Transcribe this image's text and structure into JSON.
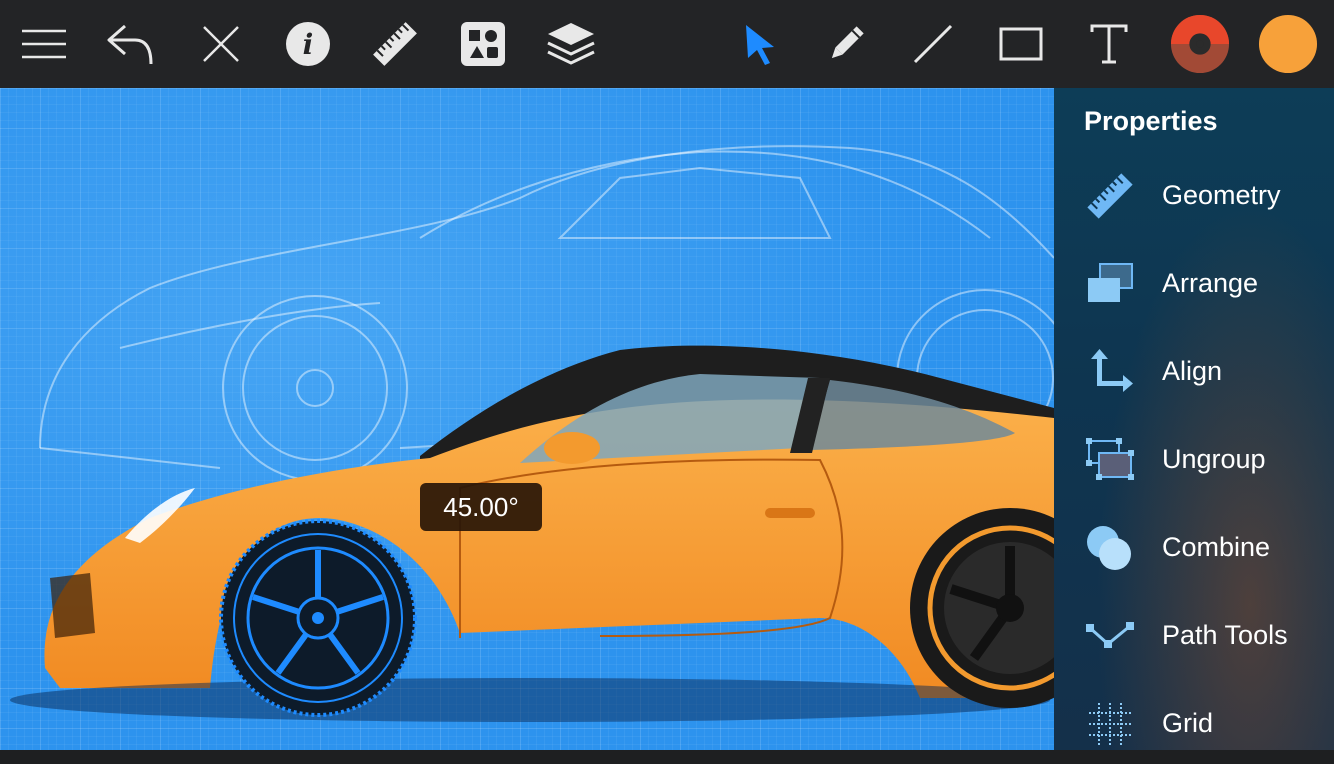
{
  "toolbar": {
    "left_icons": [
      "menu-icon",
      "undo-icon",
      "close-icon",
      "info-icon",
      "ruler-icon",
      "shapes-icon",
      "layers-icon"
    ],
    "tools": [
      "select-arrow-icon",
      "pencil-icon",
      "line-icon",
      "rectangle-icon",
      "text-icon"
    ],
    "active_tool": "select-arrow-icon",
    "stroke_color": "#e8472b",
    "fill_color": "#f7a13a",
    "accent_color": "#1e8bff"
  },
  "canvas": {
    "angle_readout": "45.00°"
  },
  "properties": {
    "title": "Properties",
    "items": [
      {
        "label": "Geometry",
        "icon": "ruler-icon"
      },
      {
        "label": "Arrange",
        "icon": "arrange-icon"
      },
      {
        "label": "Align",
        "icon": "align-icon"
      },
      {
        "label": "Ungroup",
        "icon": "ungroup-icon"
      },
      {
        "label": "Combine",
        "icon": "combine-icon"
      },
      {
        "label": "Path Tools",
        "icon": "path-tools-icon"
      },
      {
        "label": "Grid",
        "icon": "grid-icon"
      }
    ]
  }
}
